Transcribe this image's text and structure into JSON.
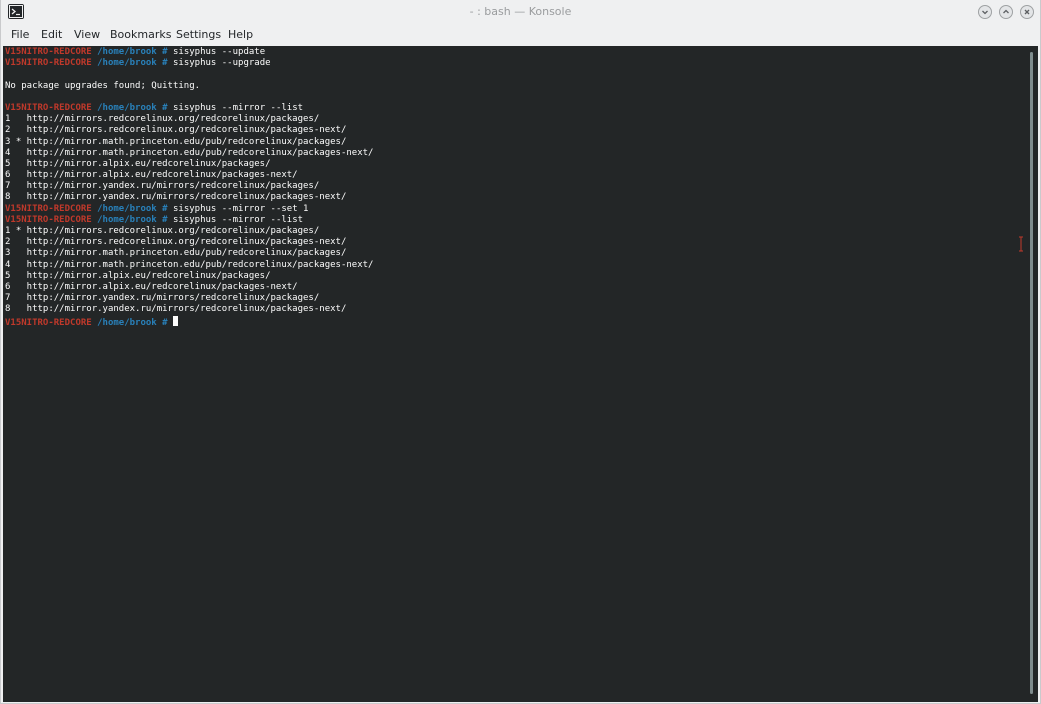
{
  "window": {
    "title": "- : bash — Konsole"
  },
  "menu": {
    "items": [
      "File",
      "Edit",
      "View",
      "Bookmarks",
      "Settings",
      "Help"
    ]
  },
  "terminal": {
    "prompt_host": "V15NITRO-REDCORE",
    "prompt_path": "/home/brook",
    "prompt_symbol": "#",
    "lines": [
      {
        "type": "prompt",
        "cmd": "sisyphus --update"
      },
      {
        "type": "prompt",
        "cmd": "sisyphus --upgrade"
      },
      {
        "type": "output",
        "text": ""
      },
      {
        "type": "output",
        "text": "No package upgrades found; Quitting."
      },
      {
        "type": "output",
        "text": ""
      },
      {
        "type": "prompt",
        "cmd": "sisyphus --mirror --list"
      },
      {
        "type": "output",
        "text": "1   http://mirrors.redcorelinux.org/redcorelinux/packages/"
      },
      {
        "type": "output",
        "text": "2   http://mirrors.redcorelinux.org/redcorelinux/packages-next/"
      },
      {
        "type": "output",
        "text": "3 * http://mirror.math.princeton.edu/pub/redcorelinux/packages/"
      },
      {
        "type": "output",
        "text": "4   http://mirror.math.princeton.edu/pub/redcorelinux/packages-next/"
      },
      {
        "type": "output",
        "text": "5   http://mirror.alpix.eu/redcorelinux/packages/"
      },
      {
        "type": "output",
        "text": "6   http://mirror.alpix.eu/redcorelinux/packages-next/"
      },
      {
        "type": "output",
        "text": "7   http://mirror.yandex.ru/mirrors/redcorelinux/packages/"
      },
      {
        "type": "output",
        "text": "8   http://mirror.yandex.ru/mirrors/redcorelinux/packages-next/"
      },
      {
        "type": "prompt",
        "cmd": "sisyphus --mirror --set 1"
      },
      {
        "type": "prompt",
        "cmd": "sisyphus --mirror --list"
      },
      {
        "type": "output",
        "text": "1 * http://mirrors.redcorelinux.org/redcorelinux/packages/"
      },
      {
        "type": "output",
        "text": "2   http://mirrors.redcorelinux.org/redcorelinux/packages-next/"
      },
      {
        "type": "output",
        "text": "3   http://mirror.math.princeton.edu/pub/redcorelinux/packages/"
      },
      {
        "type": "output",
        "text": "4   http://mirror.math.princeton.edu/pub/redcorelinux/packages-next/"
      },
      {
        "type": "output",
        "text": "5   http://mirror.alpix.eu/redcorelinux/packages/"
      },
      {
        "type": "output",
        "text": "6   http://mirror.alpix.eu/redcorelinux/packages-next/"
      },
      {
        "type": "output",
        "text": "7   http://mirror.yandex.ru/mirrors/redcorelinux/packages/"
      },
      {
        "type": "output",
        "text": "8   http://mirror.yandex.ru/mirrors/redcorelinux/packages-next/"
      },
      {
        "type": "prompt",
        "cmd": "",
        "cursor": true
      }
    ]
  },
  "colors": {
    "terminal_bg": "#232627",
    "terminal_fg": "#fcfcfc",
    "prompt_host": "#c0392b",
    "prompt_path": "#2980b9",
    "text_cursor": "#c0392b"
  },
  "icons": {
    "app": "terminal-icon",
    "minimize": "chevron-down-icon",
    "maximize": "chevron-up-icon",
    "close": "close-icon"
  }
}
